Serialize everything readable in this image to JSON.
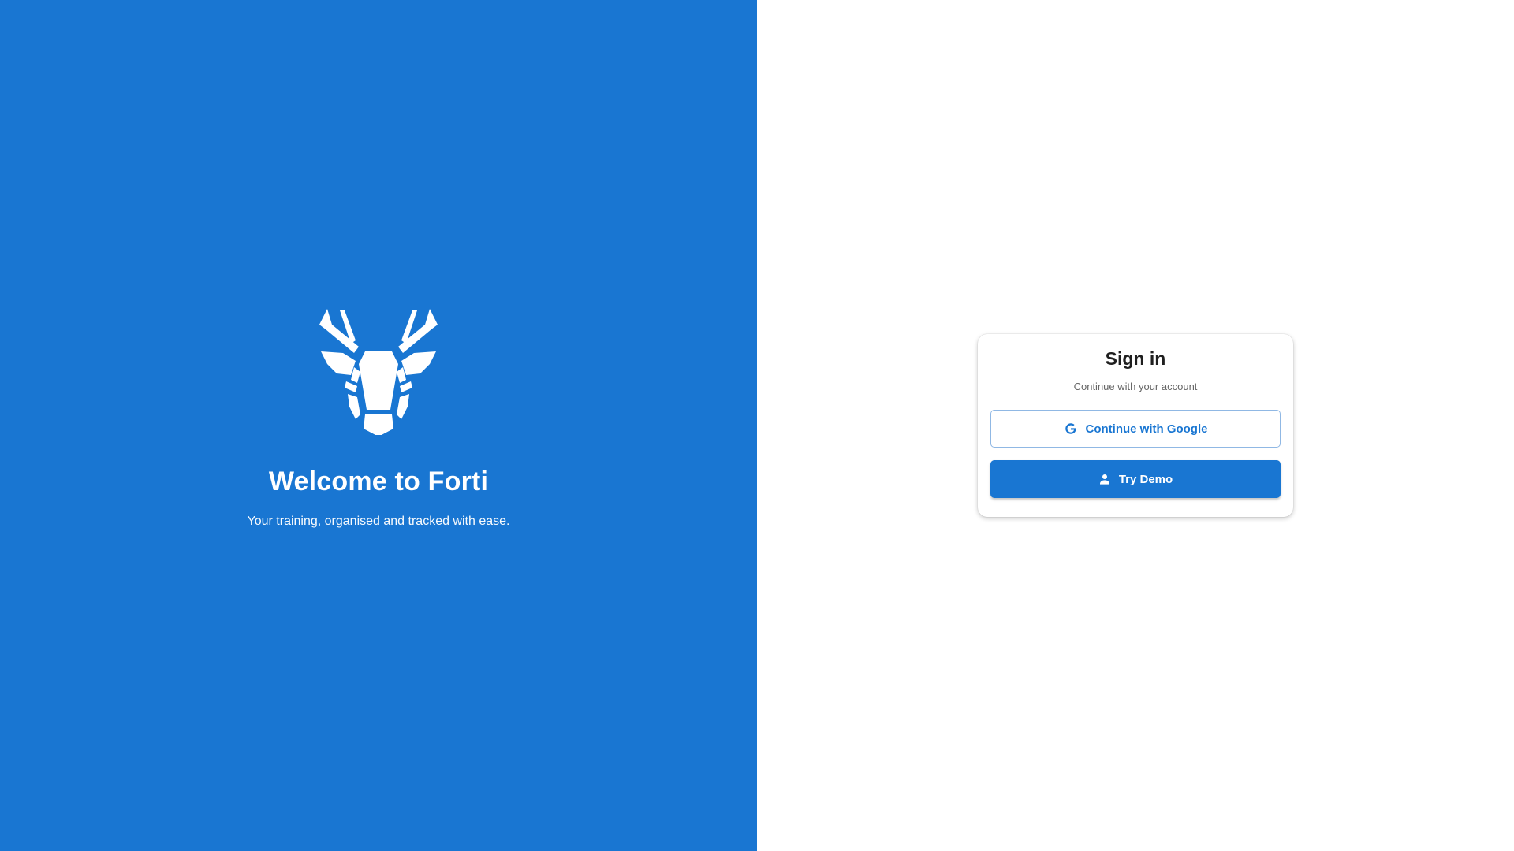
{
  "hero": {
    "title": "Welcome to Forti",
    "tagline": "Your training, organised and tracked with ease.",
    "logo_icon": "stag-head-logo-icon"
  },
  "signin": {
    "title": "Sign in",
    "subtitle": "Continue with your account",
    "google_button": {
      "label": "Continue with Google",
      "icon": "google-g-icon"
    },
    "demo_button": {
      "label": "Try Demo",
      "icon": "person-icon"
    }
  },
  "colors": {
    "brand_blue": "#1976d2",
    "background": "#ffffff",
    "title_text": "#1f1f1f",
    "subtitle_text": "#666666"
  }
}
